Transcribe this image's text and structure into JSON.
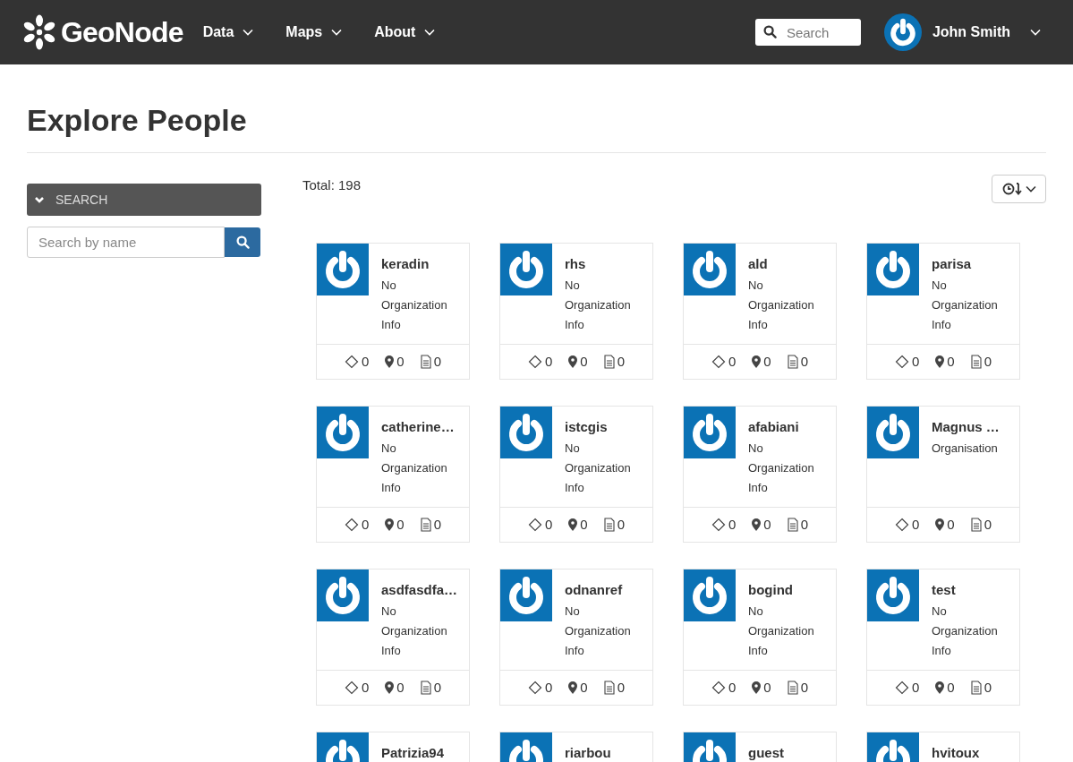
{
  "navbar": {
    "brand": "GeoNode",
    "menus": [
      {
        "label": "Data"
      },
      {
        "label": "Maps"
      },
      {
        "label": "About"
      }
    ],
    "search": {
      "placeholder": "Search"
    },
    "user": {
      "name": "John Smith"
    }
  },
  "page": {
    "title": "Explore People"
  },
  "sidebar": {
    "panel": {
      "label": "SEARCH",
      "expanded": true
    },
    "search": {
      "placeholder": "Search by name"
    }
  },
  "results": {
    "total": "Total: 198"
  },
  "people": [
    {
      "name": "keradin",
      "info": "No Organization Info",
      "stats": [
        {
          "kind": "layers",
          "count": "0"
        },
        {
          "kind": "maps",
          "count": "0"
        },
        {
          "kind": "documents",
          "count": "0"
        }
      ]
    },
    {
      "name": "rhs",
      "info": "No Organization Info",
      "stats": [
        {
          "kind": "layers",
          "count": "0"
        },
        {
          "kind": "maps",
          "count": "0"
        },
        {
          "kind": "documents",
          "count": "0"
        }
      ]
    },
    {
      "name": "ald",
      "info": "No Organization Info",
      "stats": [
        {
          "kind": "layers",
          "count": "0"
        },
        {
          "kind": "maps",
          "count": "0"
        },
        {
          "kind": "documents",
          "count": "0"
        }
      ]
    },
    {
      "name": "parisa",
      "info": "No Organization Info",
      "stats": [
        {
          "kind": "layers",
          "count": "0"
        },
        {
          "kind": "maps",
          "count": "0"
        },
        {
          "kind": "documents",
          "count": "0"
        }
      ]
    },
    {
      "name": "catherine…",
      "info": "No Organization Info",
      "stats": [
        {
          "kind": "layers",
          "count": "0"
        },
        {
          "kind": "maps",
          "count": "0"
        },
        {
          "kind": "documents",
          "count": "0"
        }
      ]
    },
    {
      "name": "istcgis",
      "info": "No Organization Info",
      "stats": [
        {
          "kind": "layers",
          "count": "0"
        },
        {
          "kind": "maps",
          "count": "0"
        },
        {
          "kind": "documents",
          "count": "0"
        }
      ]
    },
    {
      "name": "afabiani",
      "info": "No Organization Info",
      "stats": [
        {
          "kind": "layers",
          "count": "0"
        },
        {
          "kind": "maps",
          "count": "0"
        },
        {
          "kind": "documents",
          "count": "0"
        }
      ]
    },
    {
      "name": "Magnus …",
      "info": "Organisation",
      "stats": [
        {
          "kind": "layers",
          "count": "0"
        },
        {
          "kind": "maps",
          "count": "0"
        },
        {
          "kind": "documents",
          "count": "0"
        }
      ]
    },
    {
      "name": "asdfasdfa…",
      "info": "No Organization Info",
      "stats": [
        {
          "kind": "layers",
          "count": "0"
        },
        {
          "kind": "maps",
          "count": "0"
        },
        {
          "kind": "documents",
          "count": "0"
        }
      ]
    },
    {
      "name": "odnanref",
      "info": "No Organization Info",
      "stats": [
        {
          "kind": "layers",
          "count": "0"
        },
        {
          "kind": "maps",
          "count": "0"
        },
        {
          "kind": "documents",
          "count": "0"
        }
      ]
    },
    {
      "name": "bogind",
      "info": "No Organization Info",
      "stats": [
        {
          "kind": "layers",
          "count": "0"
        },
        {
          "kind": "maps",
          "count": "0"
        },
        {
          "kind": "documents",
          "count": "0"
        }
      ]
    },
    {
      "name": "test",
      "info": "No Organization Info",
      "stats": [
        {
          "kind": "layers",
          "count": "0"
        },
        {
          "kind": "maps",
          "count": "0"
        },
        {
          "kind": "documents",
          "count": "0"
        }
      ]
    },
    {
      "name": "Patrizia94"
    },
    {
      "name": "riarbou"
    },
    {
      "name": "guest"
    },
    {
      "name": "hvitoux"
    }
  ]
}
